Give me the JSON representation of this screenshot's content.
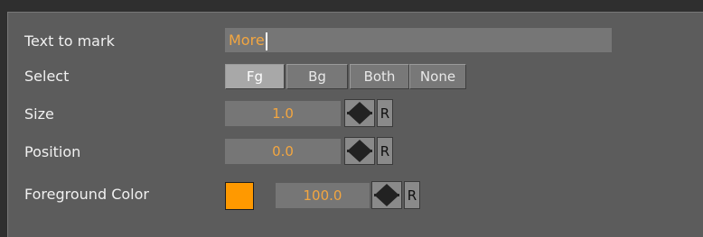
{
  "text_to_mark": {
    "label": "Text to mark",
    "value": "More"
  },
  "select": {
    "label": "Select",
    "options": [
      "Fg",
      "Bg",
      "Both",
      "None"
    ],
    "selected": "Fg"
  },
  "size": {
    "label": "Size",
    "value": "1.0",
    "reset_label": "R"
  },
  "position": {
    "label": "Position",
    "value": "0.0",
    "reset_label": "R"
  },
  "foreground_color": {
    "label": "Foreground Color",
    "swatch_color": "#ff9900",
    "value": "100.0",
    "reset_label": "R"
  },
  "colors": {
    "value_text": "#f3a640",
    "label_text": "#f0f0f0",
    "panel": "#5c5c5c"
  }
}
